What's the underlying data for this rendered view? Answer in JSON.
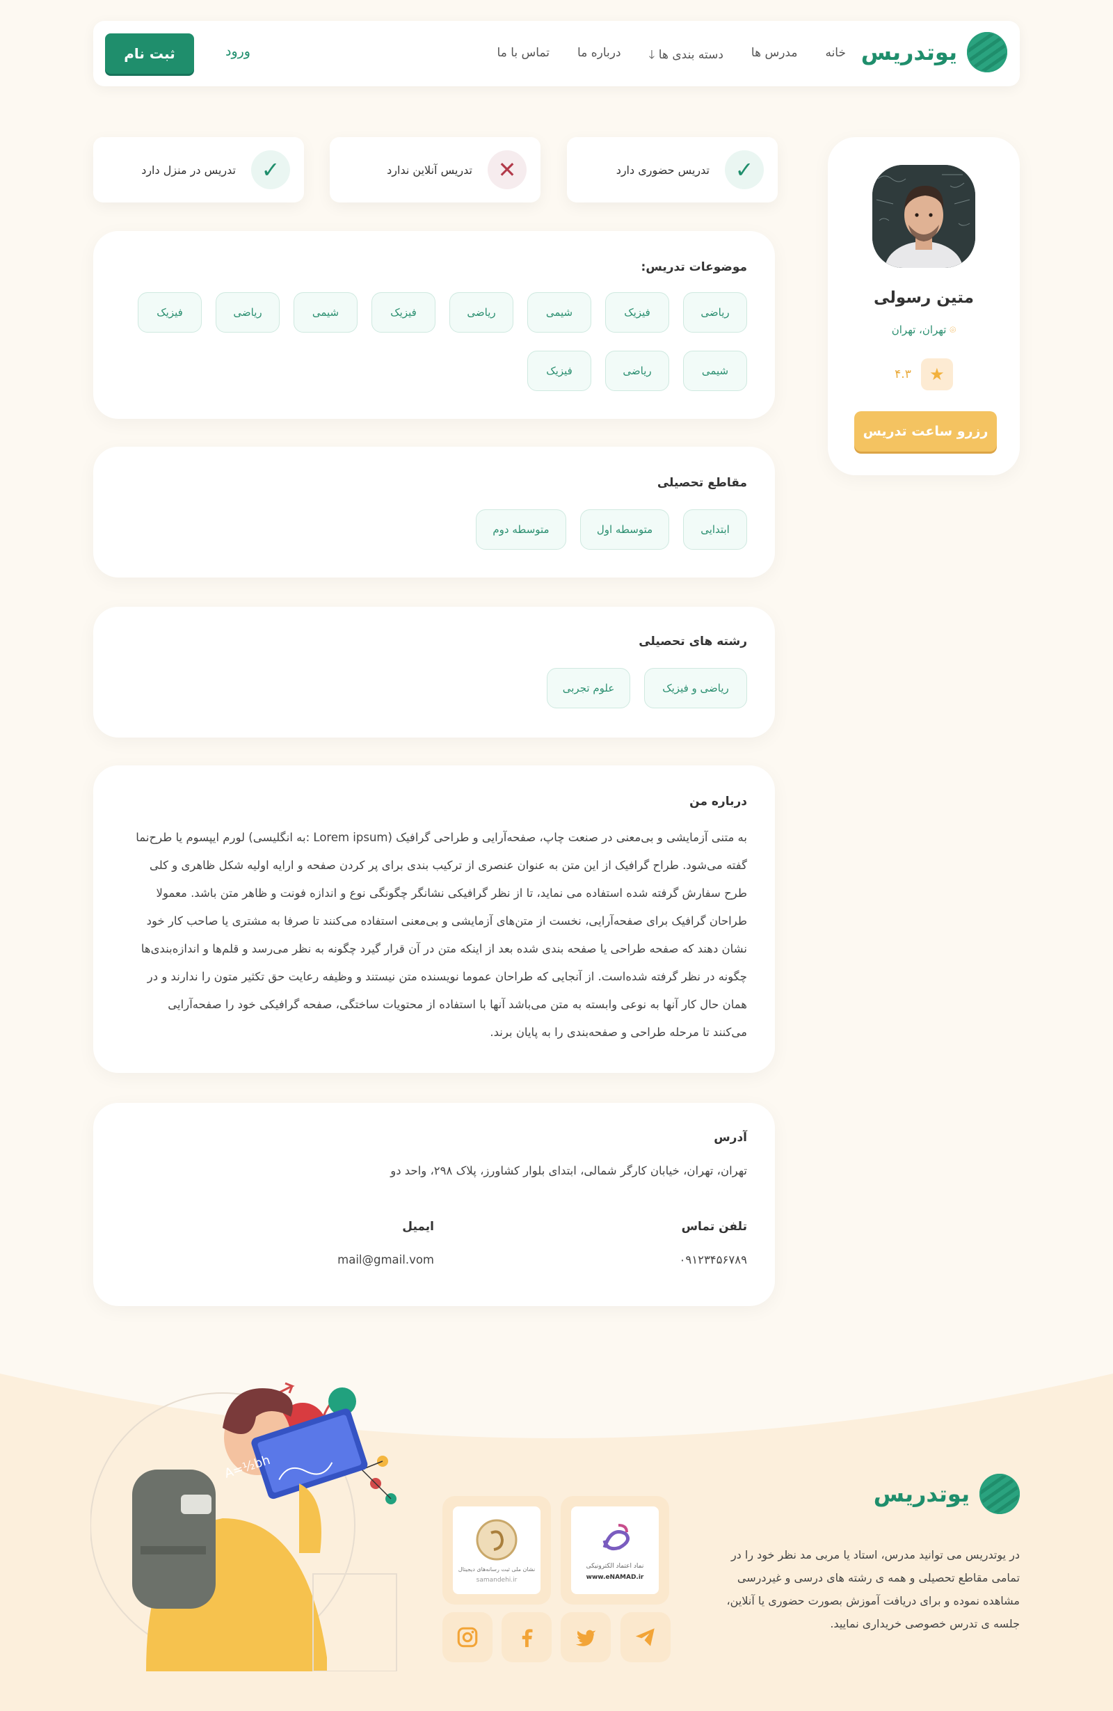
{
  "header": {
    "brand": "یوتدریس",
    "nav": [
      "خانه",
      "مدرس ها",
      "دسته بندی ها",
      "درباره ما",
      "تماس با ما"
    ],
    "login": "ورود",
    "signup": "ثبت نام"
  },
  "profile": {
    "name": "متین رسولی",
    "location": "تهران، تهران",
    "rating": "۴.۳",
    "reserve_label": "رزرو ساعت تدریس"
  },
  "features": [
    {
      "text": "تدریس حضوری دارد",
      "status": "yes"
    },
    {
      "text": "تدریس آنلاین ندارد",
      "status": "no"
    },
    {
      "text": "تدریس در منزل دارد",
      "status": "yes"
    }
  ],
  "subjects": {
    "title": "موضوعات تدریس:",
    "items": [
      "ریاضی",
      "فیزیک",
      "شیمی",
      "ریاضی",
      "فیزیک",
      "شیمی",
      "ریاضی",
      "فیزیک",
      "شیمی",
      "ریاضی",
      "فیزیک"
    ]
  },
  "grades": {
    "title": "مقاطع تحصیلی",
    "items": [
      "ابتدایی",
      "متوسطه اول",
      "متوسطه دوم"
    ]
  },
  "fields": {
    "title": "رشته های تحصیلی",
    "items": [
      "ریاضی و فیزیک",
      "علوم تجربی"
    ]
  },
  "about": {
    "title": "درباره من",
    "lines": [
      "به متنی آزمایشی و بی‌معنی در صنعت چاپ، صفحه‌آرایی و طراحی گرافیک (Lorem ipsum :به انگلیسی) لورم ایپسوم یا طرح‌نما",
      "گفته می‌شود. طراح گرافیک از این متن به عنوان عنصری از ترکیب بندی برای پر کردن صفحه و ارایه اولیه شکل ظاهری و کلی",
      "طرح سفارش گرفته شده استفاده می نماید، تا از نظر گرافیکی نشانگر چگونگی نوع و اندازه فونت و ظاهر متن باشد. معمولا",
      "طراحان گرافیک برای صفحه‌آرایی، نخست از متن‌های آزمایشی و بی‌معنی استفاده می‌کنند تا صرفا به مشتری یا صاحب کار خود",
      "نشان دهند که صفحه طراحی یا صفحه بندی شده بعد از اینکه متن در آن قرار گیرد چگونه به نظر می‌رسد و قلم‌ها و اندازه‌بندی‌ها",
      "چگونه در نظر گرفته شده‌است. از آنجایی که طراحان عموما نویسنده متن نیستند و وظیفه رعایت حق تکثیر متون را ندارند و در",
      "همان حال کار آنها به نوعی وابسته به متن می‌باشد آنها با استفاده از محتویات ساختگی، صفحه گرافیکی خود را صفحه‌آرایی",
      "می‌کنند تا مرحله طراحی و صفحه‌بندی را به پایان برند."
    ]
  },
  "contact": {
    "address_title": "آدرس",
    "address": "تهران، تهران، خیابان کارگر شمالی، ابتدای بلوار کشاورز، پلاک ۲۹۸، واحد دو",
    "phone_title": "تلفن تماس",
    "phone": "۰۹۱۲۳۴۵۶۷۸۹",
    "email_title": "ایمیل",
    "email": "mail@gmail.vom"
  },
  "footer": {
    "brand": "یوتدریس",
    "description": "در یوتدریس می توانید مدرس، استاد یا مربی مد نظر خود را در تمامی مقاطع تحصیلی و همه ی رشته های درسی و غیردرسی مشاهده نموده و برای دریافت آموزش بصورت حضوری یا آنلاین، جلسه ی تدرس خصوصی خریداری نمایید.",
    "badges": [
      {
        "name": "enamad",
        "caption": "نماد اعتماد الکترونیکی",
        "url_text": "www.eNAMAD.ir"
      },
      {
        "name": "samandehi",
        "caption": "نشان ملی ثبت رسانه‌های دیجیتال",
        "url_text": "samandehi.ir"
      }
    ],
    "socials": [
      "telegram-icon",
      "twitter-icon",
      "facebook-icon",
      "instagram-icon"
    ]
  },
  "colors": {
    "primary": "#1f8e6c",
    "accent": "#f4c361",
    "background": "#fdf9f2",
    "danger": "#b23a4a"
  }
}
